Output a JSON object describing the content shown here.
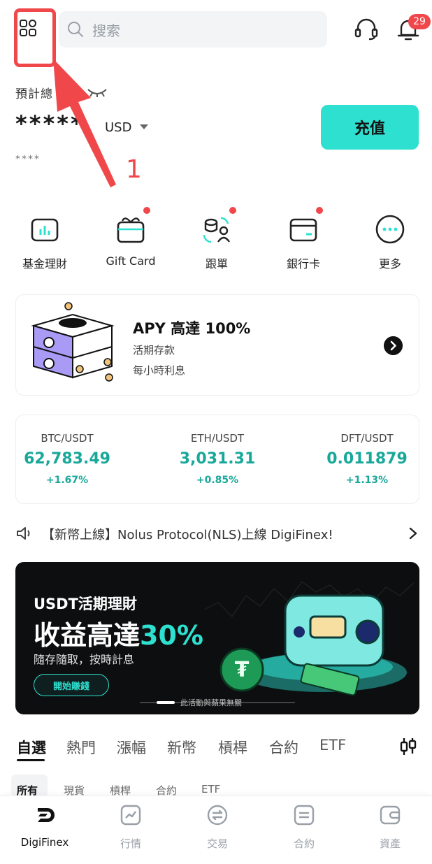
{
  "header": {
    "search_placeholder": "搜索",
    "notification_count": "29",
    "menu_icon": "grid-menu-icon",
    "support_icon": "headset-icon",
    "bell_icon": "bell-icon"
  },
  "annotation": {
    "step_number": "1",
    "color": "#f0474b"
  },
  "balance": {
    "label": "預計總",
    "value": "*****",
    "currency": "USD",
    "sub_value": "****",
    "deposit_label": "充值"
  },
  "quick_actions": [
    {
      "label": "基金理財",
      "icon": "fund-chart-icon",
      "dot": false
    },
    {
      "label": "Gift Card",
      "icon": "gift-card-icon",
      "dot": true
    },
    {
      "label": "跟單",
      "icon": "copy-trade-icon",
      "dot": true
    },
    {
      "label": "銀行卡",
      "icon": "bank-card-icon",
      "dot": true
    },
    {
      "label": "更多",
      "icon": "more-icon",
      "dot": false
    }
  ],
  "promo": {
    "title": "APY 高達 100%",
    "subtitle1": "活期存款",
    "subtitle2": "每小時利息"
  },
  "tickers": [
    {
      "pair": "BTC/USDT",
      "price": "62,783.49",
      "change": "+1.67%"
    },
    {
      "pair": "ETH/USDT",
      "price": "3,031.31",
      "change": "+0.85%"
    },
    {
      "pair": "DFT/USDT",
      "price": "0.011879",
      "change": "+1.13%"
    }
  ],
  "announcement": {
    "text": "【新幣上線】Nolus Protocol(NLS)上線 DigiFinex!"
  },
  "banner": {
    "line1": "USDT活期理財",
    "line2_prefix": "收益高達",
    "line2_accent": "30%",
    "line3": "隨存隨取，按時計息",
    "button": "開始賺錢",
    "note": "此活動與蘋果無關"
  },
  "market_tabs": [
    "自選",
    "熱門",
    "漲幅",
    "新幣",
    "槓桿",
    "合約",
    "ETF"
  ],
  "sub_tabs": [
    "所有",
    "現貨",
    "槓桿",
    "合約",
    "ETF"
  ],
  "bottom_nav": [
    {
      "label": "DigiFinex",
      "icon": "digifinex-logo-icon",
      "active": true
    },
    {
      "label": "行情",
      "icon": "market-chart-icon",
      "active": false
    },
    {
      "label": "交易",
      "icon": "trade-exchange-icon",
      "active": false
    },
    {
      "label": "合約",
      "icon": "contract-icon",
      "active": false
    },
    {
      "label": "資產",
      "icon": "wallet-icon",
      "active": false
    }
  ],
  "colors": {
    "accent": "#2ee0cf",
    "positive": "#18a89a",
    "alert": "#f0474b"
  }
}
